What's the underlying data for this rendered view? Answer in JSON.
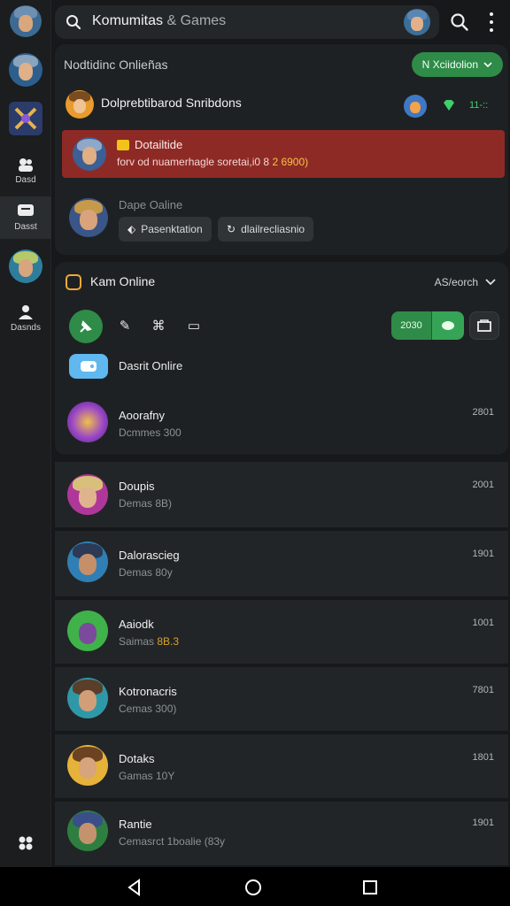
{
  "header": {
    "title_main": "Komumitas",
    "title_dim": "& Games",
    "search_icon": "search-icon",
    "more_icon": "more-vertical-icon"
  },
  "rail": {
    "items": [
      {
        "label": "",
        "icon": "avatar-knight"
      },
      {
        "label": "",
        "icon": "avatar-knight-2"
      },
      {
        "label": "",
        "icon": "crossed-swords-icon"
      },
      {
        "label": "Dasd",
        "icon": "community-icon"
      },
      {
        "label": "Dasst",
        "icon": "chat-icon",
        "active": true
      },
      {
        "label": "",
        "icon": "avatar-knight-3"
      },
      {
        "label": "Dasnds",
        "icon": "people-icon"
      },
      {
        "label": "",
        "icon": "grid-icon"
      }
    ]
  },
  "notifications": {
    "heading": "Nodtidinc Onlieñas",
    "pill_label": "N Xciidolion",
    "row1": {
      "title": "Dolprebtibarod Snribdons",
      "count": "11-::"
    },
    "alert": {
      "title": "Dotailtide",
      "text": "forv od nuamerhagle soretai,i0 8",
      "highlight": "2 6900)"
    },
    "row3": {
      "title": "Dape Oaline",
      "chip1": "Pasenktation",
      "chip2": "dlailrecliasnio"
    }
  },
  "online": {
    "heading": "Kam Online",
    "sort_label": "AS/eorch",
    "seg_label": "2030",
    "game_label": "Dasrit Onlire"
  },
  "friends": [
    {
      "name": "Aoorafny",
      "sub": "Dcmmes 300",
      "sub_hl": "",
      "time": "2801"
    },
    {
      "name": "Doupis",
      "sub": "Demas 8B)",
      "sub_hl": "",
      "time": "2001"
    },
    {
      "name": "Dalorascieg",
      "sub": "Demas 80y",
      "sub_hl": "",
      "time": "1901"
    },
    {
      "name": "Aaiodk",
      "sub": "Saimas",
      "sub_hl": "8B.3",
      "time": "1001"
    },
    {
      "name": "Kotronacris",
      "sub": "Cemas 300)",
      "sub_hl": "",
      "time": "7801"
    },
    {
      "name": "Dotaks",
      "sub": "Gamas 10Y",
      "sub_hl": "",
      "time": "1801"
    },
    {
      "name": "Rantie",
      "sub": "Cemasrct 1boalie (83y",
      "sub_hl": "",
      "time": "1901"
    }
  ],
  "colors": {
    "accent_green": "#2e8b48",
    "alert_red": "#8e2a25",
    "background": "#161819",
    "card": "#1e2123"
  }
}
